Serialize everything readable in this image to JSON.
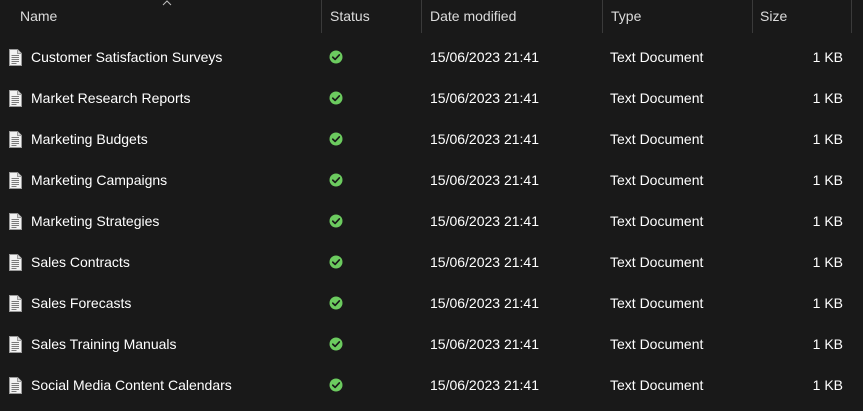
{
  "columns": {
    "name": "Name",
    "status": "Status",
    "date_modified": "Date modified",
    "type": "Type",
    "size": "Size"
  },
  "sort": {
    "column": "name",
    "direction": "ascending",
    "icon": "chevron-up-icon"
  },
  "files": [
    {
      "name": "Customer Satisfaction Surveys",
      "status": "available",
      "date_modified": "15/06/2023 21:41",
      "type": "Text Document",
      "size": "1 KB"
    },
    {
      "name": "Market Research Reports",
      "status": "available",
      "date_modified": "15/06/2023 21:41",
      "type": "Text Document",
      "size": "1 KB"
    },
    {
      "name": "Marketing Budgets",
      "status": "available",
      "date_modified": "15/06/2023 21:41",
      "type": "Text Document",
      "size": "1 KB"
    },
    {
      "name": "Marketing Campaigns",
      "status": "available",
      "date_modified": "15/06/2023 21:41",
      "type": "Text Document",
      "size": "1 KB"
    },
    {
      "name": "Marketing Strategies",
      "status": "available",
      "date_modified": "15/06/2023 21:41",
      "type": "Text Document",
      "size": "1 KB"
    },
    {
      "name": "Sales Contracts",
      "status": "available",
      "date_modified": "15/06/2023 21:41",
      "type": "Text Document",
      "size": "1 KB"
    },
    {
      "name": "Sales Forecasts",
      "status": "available",
      "date_modified": "15/06/2023 21:41",
      "type": "Text Document",
      "size": "1 KB"
    },
    {
      "name": "Sales Training Manuals",
      "status": "available",
      "date_modified": "15/06/2023 21:41",
      "type": "Text Document",
      "size": "1 KB"
    },
    {
      "name": "Social Media Content Calendars",
      "status": "available",
      "date_modified": "15/06/2023 21:41",
      "type": "Text Document",
      "size": "1 KB"
    }
  ],
  "colors": {
    "background": "#191919",
    "text": "#ffffff",
    "header_text": "#dcdcdc",
    "status_ok": "#6ccb5f"
  },
  "icons": {
    "file": "text-document-icon",
    "status": "check-circle-icon"
  }
}
